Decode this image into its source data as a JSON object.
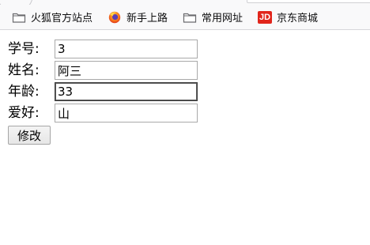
{
  "bookmarks": [
    {
      "label": "火狐官方站点",
      "icon": "folder-icon"
    },
    {
      "label": "新手上路",
      "icon": "firefox-icon"
    },
    {
      "label": "常用网址",
      "icon": "folder-icon"
    },
    {
      "label": "京东商城",
      "icon": "jd-logo-icon",
      "logo_text": "JD"
    }
  ],
  "form": {
    "fields": [
      {
        "label": "学号:",
        "value": "3"
      },
      {
        "label": "姓名:",
        "value": "阿三"
      },
      {
        "label": "年龄:",
        "value": "33"
      },
      {
        "label": "爱好:",
        "value": "山"
      }
    ],
    "submit_label": "修改"
  },
  "colors": {
    "jd_red": "#e1251b",
    "bar_bg": "#f9f9fa"
  }
}
